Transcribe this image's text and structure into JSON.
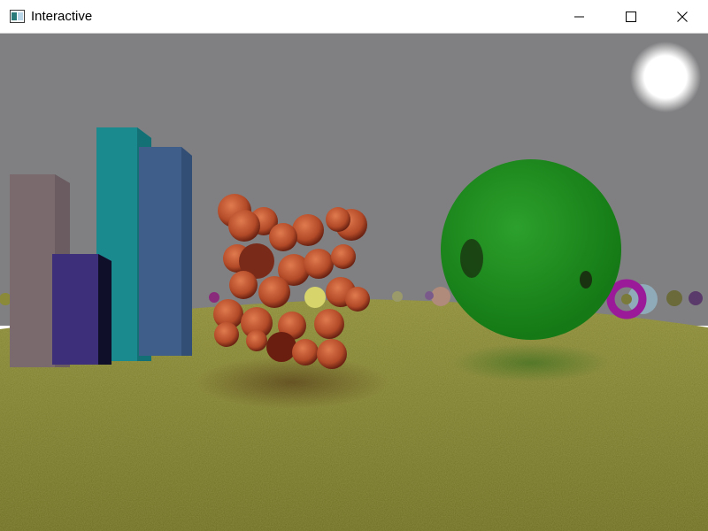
{
  "window": {
    "title": "Interactive",
    "controls": {
      "minimize_icon": "minimize-icon",
      "maximize_icon": "maximize-icon",
      "close_icon": "close-icon"
    }
  },
  "scene": {
    "sky_color": "#808082",
    "ground_color": "#7a7a2a",
    "sun_color": "#ffffff",
    "objects": [
      "pink-box",
      "cyan-box",
      "blue-box",
      "purple-box",
      "copper-sphere-cluster",
      "green-sphere",
      "magenta-torus",
      "distant-spheres"
    ]
  }
}
